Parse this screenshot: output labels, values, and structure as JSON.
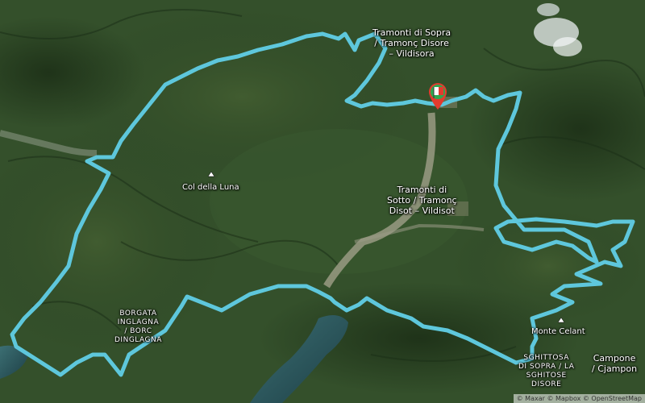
{
  "map": {
    "places": [
      {
        "id": "tramonti-sopra",
        "text": "Tramonti di Sopra\n/ Tramonç Disore\n– Vildisora"
      },
      {
        "id": "tramonti-sotto",
        "text": "Tramonti di\nSotto / Tramonç\nDisot – Vildisot"
      },
      {
        "id": "borgata-inglagna",
        "text": "BORGATA\nINGLAGNA\n/ BORC\nDINGLAGNA"
      },
      {
        "id": "sghittosa",
        "text": "SGHITTOSA\nDI SOPRA / LA\nSGHITOSE\nDISORE"
      },
      {
        "id": "campone",
        "text": "Campone\n/ Cjampon"
      }
    ],
    "peaks": [
      {
        "id": "col-della-luna",
        "text": "Col della Luna"
      },
      {
        "id": "monte-celant",
        "text": "Monte Celant"
      }
    ],
    "route_color": "#5ec7dc",
    "start_marker_colors": [
      "#2fa84f",
      "#ffffff",
      "#e23b2e"
    ],
    "attribution": "© Maxar © Mapbox © OpenStreetMap"
  }
}
